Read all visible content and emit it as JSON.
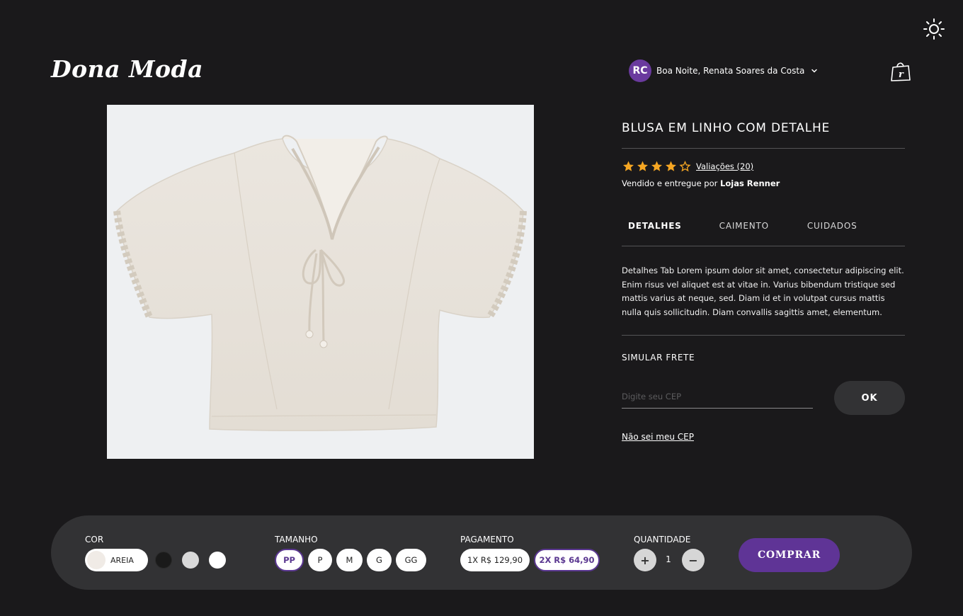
{
  "brand": {
    "logo": "Dona Moda"
  },
  "header": {
    "theme_toggle_icon": "sun-icon",
    "user": {
      "initials": "RC",
      "greeting": "Boa Noite, Renata Soares da Costa",
      "avatar_color": "#6a3a9e"
    },
    "cart_icon": "shopping-bag-icon"
  },
  "product": {
    "image_alt": "Blusa em linho com detalhe",
    "title": "BLUSA EM LINHO COM DETALHE",
    "rating": {
      "value": 4,
      "max": 5,
      "reviews_label": "Valiações (20)"
    },
    "seller": {
      "prefix": "Vendido e entregue por",
      "name": "Lojas Renner"
    },
    "tabs": [
      {
        "label": "DETALHES",
        "active": true
      },
      {
        "label": "CAIMENTO",
        "active": false
      },
      {
        "label": "CUIDADOS",
        "active": false
      }
    ],
    "description": "Detalhes Tab Lorem ipsum dolor sit amet, consectetur adipiscing elit. Enim risus vel aliquet est at vitae in. Varius bibendum tristique sed mattis varius at neque, sed. Diam id et in volutpat cursus mattis nulla quis sollicitudin. Diam convallis sagittis amet, elementum."
  },
  "shipping": {
    "label": "SIMULAR FRETE",
    "cep_placeholder": "Digite seu CEP",
    "ok_label": "OK",
    "unknown_cep_link": "Não sei meu CEP"
  },
  "purchase_bar": {
    "color": {
      "label": "COR",
      "selected_name": "AREIA",
      "options": [
        "#f0ebe6",
        "#1a1a1a",
        "#d9d9d9",
        "#ffffff"
      ]
    },
    "size": {
      "label": "TAMANHO",
      "options": [
        "PP",
        "P",
        "M",
        "G",
        "GG"
      ],
      "selected": "PP"
    },
    "payment": {
      "label": "PAGAMENTO",
      "options": [
        "1X R$ 129,90",
        "2X R$ 64,90"
      ],
      "selected": "2X R$ 64,90"
    },
    "quantity": {
      "label": "QUANTIDADE",
      "value": "1",
      "plus": "+",
      "minus": "−"
    },
    "buy_label": "COMPRAR"
  },
  "colors": {
    "accent": "#5f3496",
    "star": "#f5a623",
    "background": "#1a191b",
    "bar": "#323234"
  }
}
